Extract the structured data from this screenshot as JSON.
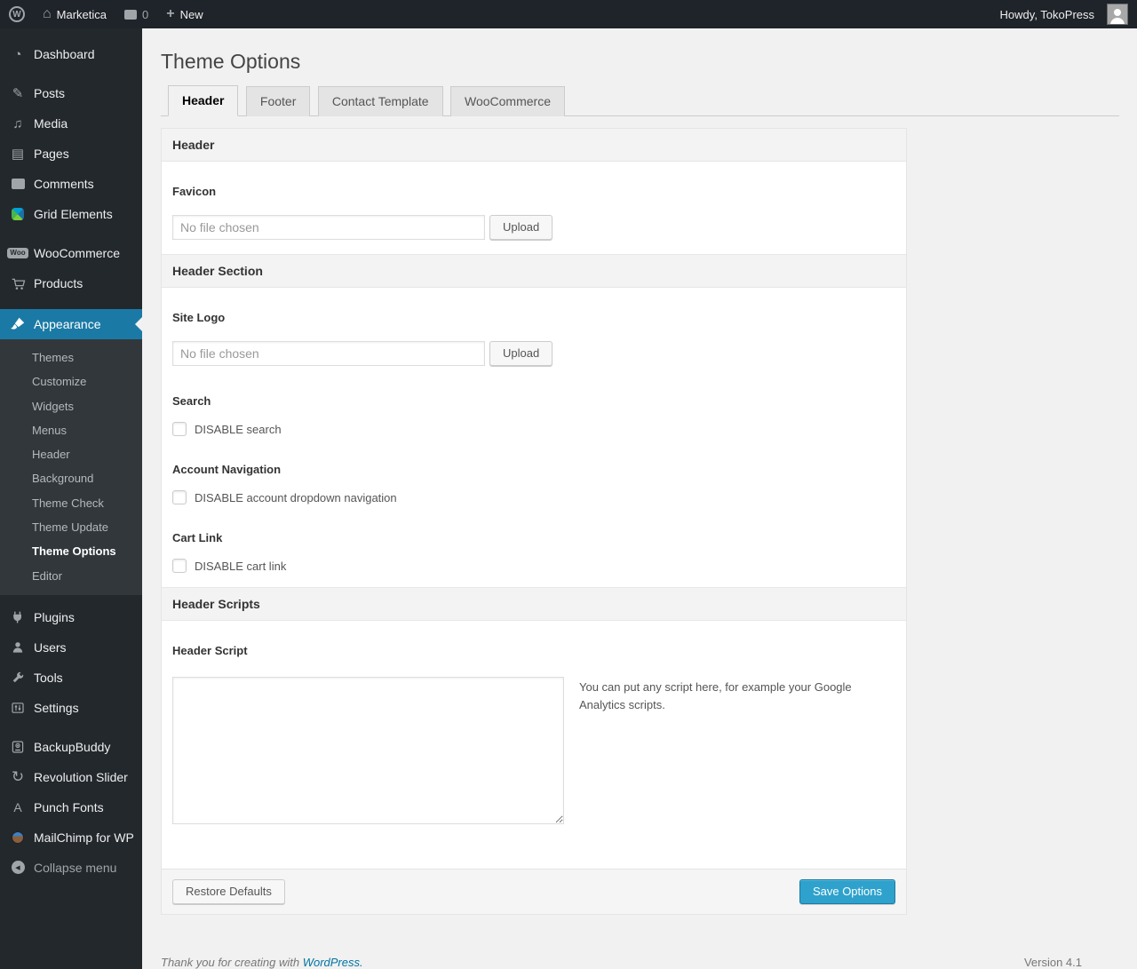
{
  "admin_bar": {
    "site_name": "Marketica",
    "comment_count": "0",
    "new_label": "New",
    "howdy": "Howdy, TokoPress"
  },
  "icons": {
    "wp_logo": "W",
    "home": "⌂",
    "dashboard": "◔",
    "posts": "✎",
    "media": "♫",
    "pages": "▤",
    "woo_badge": "Woo",
    "refresh": "↻",
    "punch_fonts": "A",
    "collapse": "◀"
  },
  "sidebar": {
    "items": [
      {
        "label": "Dashboard"
      },
      {
        "label": "Posts"
      },
      {
        "label": "Media"
      },
      {
        "label": "Pages"
      },
      {
        "label": "Comments"
      },
      {
        "label": "Grid Elements"
      },
      {
        "label": "WooCommerce"
      },
      {
        "label": "Products"
      },
      {
        "label": "Appearance"
      },
      {
        "label": "Plugins"
      },
      {
        "label": "Users"
      },
      {
        "label": "Tools"
      },
      {
        "label": "Settings"
      },
      {
        "label": "BackupBuddy"
      },
      {
        "label": "Revolution Slider"
      },
      {
        "label": "Punch Fonts"
      },
      {
        "label": "MailChimp for WP"
      }
    ],
    "appearance_submenu": [
      "Themes",
      "Customize",
      "Widgets",
      "Menus",
      "Header",
      "Background",
      "Theme Check",
      "Theme Update",
      "Theme Options",
      "Editor"
    ],
    "collapse_label": "Collapse menu"
  },
  "page": {
    "title": "Theme Options",
    "tabs": [
      {
        "label": "Header",
        "active": true
      },
      {
        "label": "Footer",
        "active": false
      },
      {
        "label": "Contact Template",
        "active": false
      },
      {
        "label": "WooCommerce",
        "active": false
      }
    ]
  },
  "panel": {
    "section_header": "Header",
    "favicon_label": "Favicon",
    "file_placeholder": "No file chosen",
    "upload_label": "Upload",
    "section_header_section": "Header Section",
    "site_logo_label": "Site Logo",
    "search_label": "Search",
    "search_checkbox": "DISABLE search",
    "account_label": "Account Navigation",
    "account_checkbox": "DISABLE account dropdown navigation",
    "cart_label": "Cart Link",
    "cart_checkbox": "DISABLE cart link",
    "section_scripts": "Header Scripts",
    "script_label": "Header Script",
    "script_note": "You can put any script here, for example your Google Analytics scripts.",
    "restore_label": "Restore Defaults",
    "save_label": "Save Options"
  },
  "footer": {
    "thanks_text": "Thank you for creating with",
    "thanks_link": "WordPress.",
    "version": "Version 4.1"
  },
  "colors": {
    "menu_highlight": "#1b7aa5",
    "button_primary": "#2ea2cc",
    "link": "#0074a2",
    "admin_bar_bg": "#1f242a",
    "menu_bg": "#23282d",
    "submenu_bg": "#32373c",
    "page_bg": "#f1f1f1"
  }
}
